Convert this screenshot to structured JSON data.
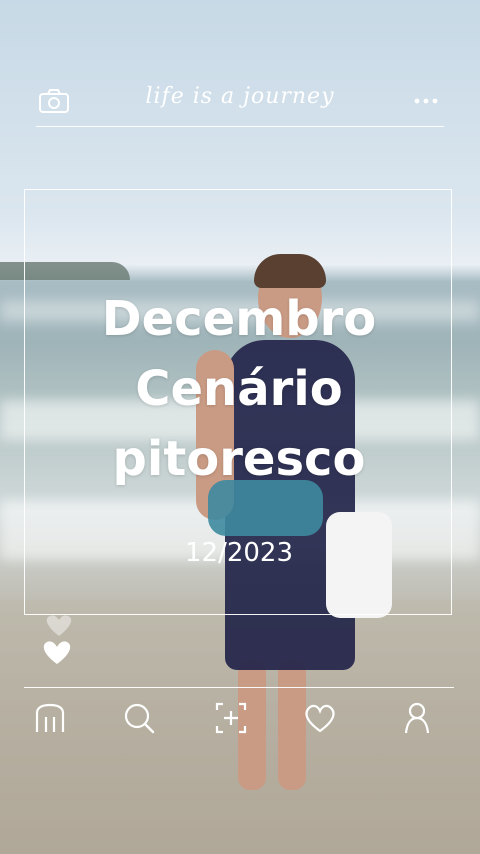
{
  "header": {
    "tagline": "life is a journey",
    "camera_icon": "camera-icon",
    "more_icon": "more-dots-icon"
  },
  "card": {
    "title_line1": "Decembro",
    "title_line2": "Cenário",
    "title_line3": "pitoresco",
    "date": "12/2023"
  },
  "reactions": {
    "icon": "heart-icon"
  },
  "nav": {
    "items": [
      {
        "icon": "home-icon"
      },
      {
        "icon": "search-icon"
      },
      {
        "icon": "add-photo-icon"
      },
      {
        "icon": "heart-icon"
      },
      {
        "icon": "profile-icon"
      }
    ]
  },
  "colors": {
    "overlay": "#ffffff",
    "sky": "#c7d9e6",
    "sea": "#9fb4b8",
    "sand": "#b6afa3"
  }
}
